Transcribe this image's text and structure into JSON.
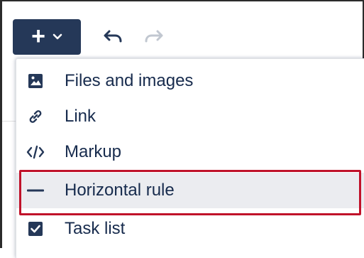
{
  "toolbar": {
    "insert_button": {
      "glyph": "+",
      "icon": "chevron-down-icon"
    },
    "undo": {
      "icon": "undo-icon"
    },
    "redo": {
      "icon": "redo-icon"
    }
  },
  "menu": {
    "items": [
      {
        "label": "Files and images",
        "icon": "image-icon"
      },
      {
        "label": "Link",
        "icon": "link-icon"
      },
      {
        "label": "Markup",
        "icon": "code-icon"
      },
      {
        "label": "Horizontal rule",
        "icon": "horizontal-rule-icon",
        "hovered": true
      },
      {
        "label": "Task list",
        "icon": "checkbox-icon"
      }
    ]
  },
  "colors": {
    "primary_button": "#253858",
    "text": "#172b4d",
    "hover_bg": "#ebecf0",
    "annotation_red": "#c0122a"
  }
}
